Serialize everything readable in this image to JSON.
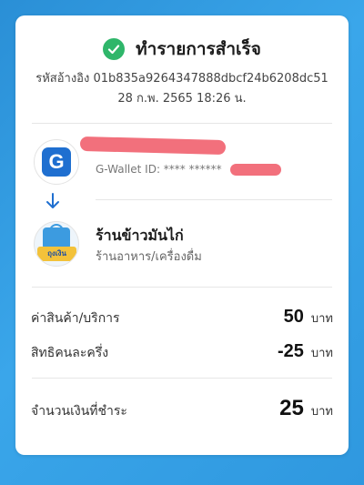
{
  "receipt": {
    "title": "ทำรายการสำเร็จ",
    "reference": "รหัสอ้างอิง 01b835a9264347888dbcf24b6208dc51",
    "datetime": "28 ก.พ. 2565 18:26 น."
  },
  "sender": {
    "logo_letter": "G",
    "wallet_id": "G-Wallet ID: **** ******"
  },
  "merchant": {
    "logo_text": "ถุงเงิน",
    "name": "ร้านข้าวมันไก่",
    "category": "ร้านอาหาร/เครื่องดื่ม"
  },
  "summary": {
    "rows": [
      {
        "label": "ค่าสินค้า/บริการ",
        "amount": "50",
        "unit": "บาท"
      },
      {
        "label": "สิทธิคนละครึ่ง",
        "amount": "-25",
        "unit": "บาท"
      }
    ],
    "total": {
      "label": "จำนวนเงินที่ชำระ",
      "amount": "25",
      "unit": "บาท"
    }
  },
  "colors": {
    "success": "#2fb66a",
    "brand_blue": "#1f6fd0",
    "background": "#3aa6ea",
    "redaction": "#f2707c"
  },
  "icons": {
    "success": "check-circle-icon",
    "transfer": "arrow-down-icon"
  }
}
